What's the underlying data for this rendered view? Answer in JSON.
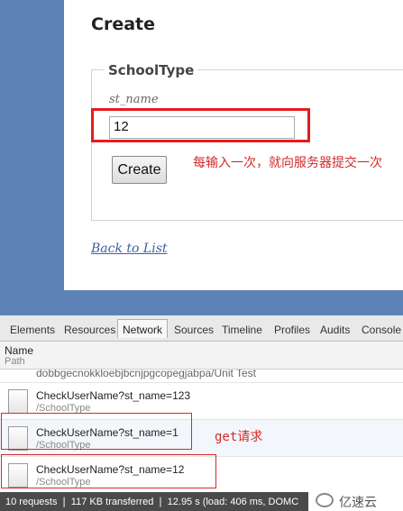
{
  "page": {
    "title": "Create",
    "legend": "SchoolType",
    "field_label": "st_name",
    "field_value": "12",
    "create_button": "Create",
    "annotation": "每输入一次，就向服务器提交一次",
    "back_link": "Back to List"
  },
  "devtools": {
    "tabs": [
      "Elements",
      "Resources",
      "Network",
      "Sources",
      "Timeline",
      "Profiles",
      "Audits",
      "Console"
    ],
    "active_tab": "Network",
    "column_name": "Name",
    "column_path": "Path",
    "partial_row": "dobbgecnokkloebjbcnjpgcopegjabpa/Unit Test",
    "requests": [
      {
        "name": "CheckUserName?st_name=123",
        "path": "/SchoolType"
      },
      {
        "name": "CheckUserName?st_name=1",
        "path": "/SchoolType"
      },
      {
        "name": "CheckUserName?st_name=12",
        "path": "/SchoolType"
      }
    ],
    "annotation": "get请求",
    "status": "10 requests ❘ 117 KB transferred ❘ 12.95 s (load: 406 ms, DOMC"
  },
  "watermark": "亿速云",
  "colors": {
    "background": "#5e82b6",
    "highlight": "#e51c1c",
    "annotation": "#d42a2a",
    "link": "#3d5fa0"
  }
}
